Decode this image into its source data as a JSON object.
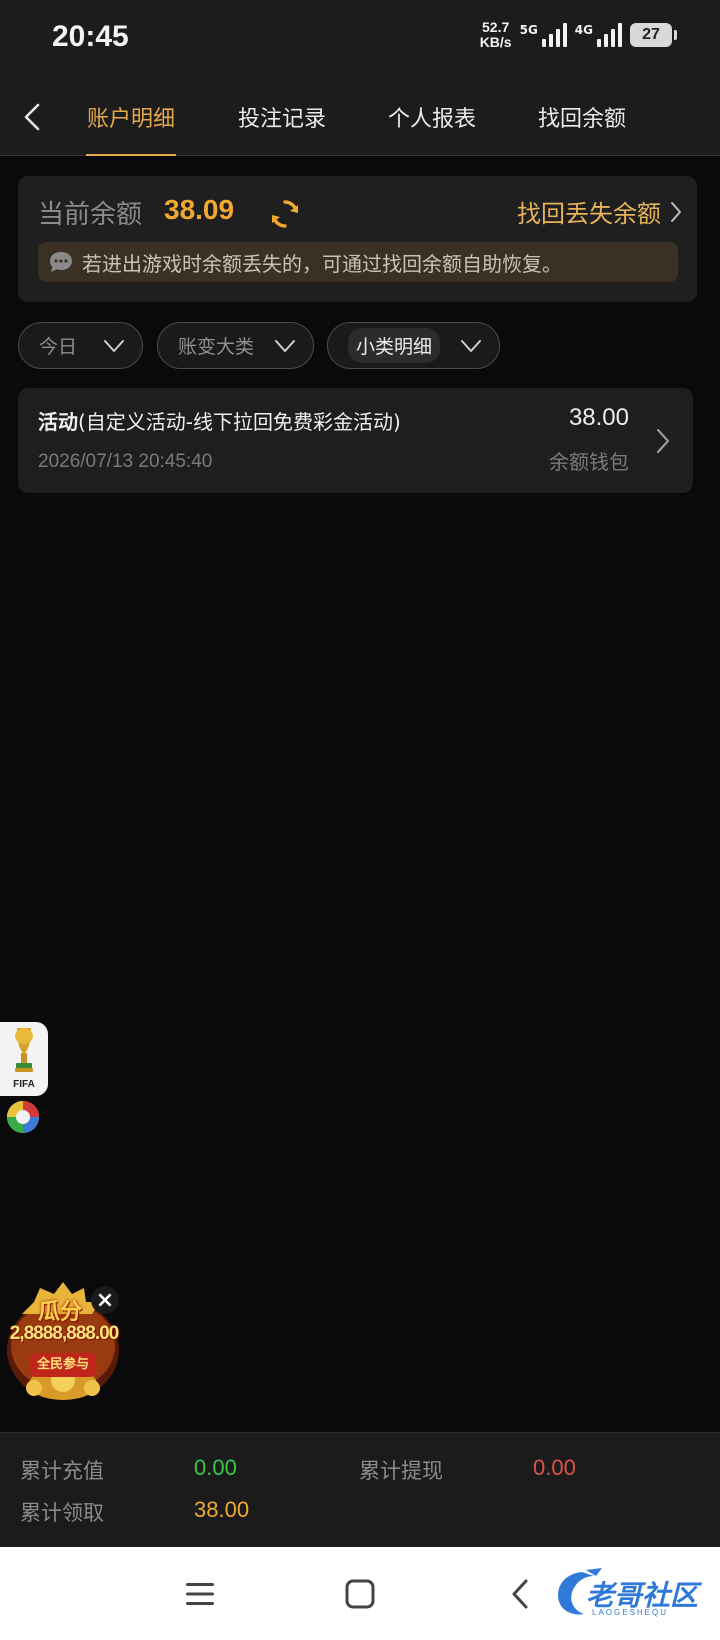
{
  "status_bar": {
    "time": "20:45",
    "net_speed_value": "52.7",
    "net_speed_unit": "KB/s",
    "sim1_label": "5G",
    "sim2_label": "4G",
    "battery_level": "27"
  },
  "nav": {
    "tabs": [
      {
        "label": "账户明细",
        "active": true
      },
      {
        "label": "投注记录",
        "active": false
      },
      {
        "label": "个人报表",
        "active": false
      },
      {
        "label": "找回余额",
        "active": false
      }
    ]
  },
  "balance": {
    "label": "当前余额",
    "value": "38.09",
    "recover_link": "找回丢失余额",
    "notice": "若进出游戏时余额丢失的，可通过找回余额自助恢复。"
  },
  "filters": [
    {
      "label": "今日"
    },
    {
      "label": "账变大类"
    },
    {
      "label": "小类明细"
    }
  ],
  "records": [
    {
      "type": "活动",
      "detail": "(自定义活动-线下拉回免费彩金活动)",
      "datetime": "2026/07/13 20:45:40",
      "amount": "38.00",
      "wallet": "余额钱包"
    }
  ],
  "floating": {
    "fifa_label": "FIFA",
    "promo_line1": "瓜分",
    "promo_line2": "2,8888,888.00",
    "promo_line3": "全民参与"
  },
  "summary": {
    "recharge_label": "累计充值",
    "recharge_value": "0.00",
    "withdraw_label": "累计提现",
    "withdraw_value": "0.00",
    "claim_label": "累计领取",
    "claim_value": "38.00"
  },
  "watermark": {
    "text": "老哥社区",
    "sub": "LAOGESHEQU"
  },
  "colors": {
    "accent_gold": "#e6a84a",
    "balance_orange": "#f0a830",
    "green": "#3cc34a",
    "red": "#e0504a"
  }
}
